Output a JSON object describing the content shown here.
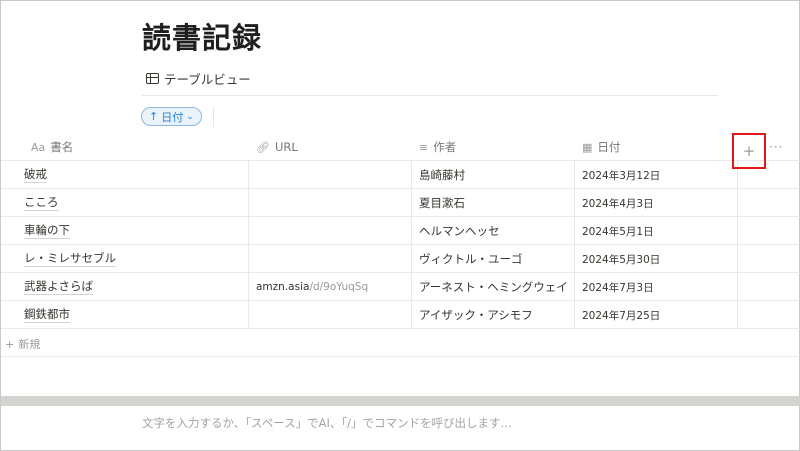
{
  "page": {
    "title": "読書記録",
    "view_name": "テーブルビュー",
    "view_icon": "table-icon"
  },
  "sort": {
    "label": "日付",
    "direction_icon": "arrow-up-icon",
    "chevron": "chevron-down-icon"
  },
  "columns": [
    {
      "id": "name",
      "label": "書名",
      "prefix": "Aa",
      "icon": "title-icon"
    },
    {
      "id": "url",
      "label": "URL",
      "icon": "link-icon"
    },
    {
      "id": "author",
      "label": "作者",
      "icon": "text-lines-icon"
    },
    {
      "id": "date",
      "label": "日付",
      "icon": "calendar-icon"
    }
  ],
  "rows": [
    {
      "name": "破戒",
      "url_host": "",
      "url_path": "",
      "author": "島崎藤村",
      "date": "2024年3月12日"
    },
    {
      "name": "こころ",
      "url_host": "",
      "url_path": "",
      "author": "夏目漱石",
      "date": "2024年4月3日"
    },
    {
      "name": "車輪の下",
      "url_host": "",
      "url_path": "",
      "author": "ヘルマンヘッセ",
      "date": "2024年5月1日"
    },
    {
      "name": "レ・ミレサセブル",
      "url_host": "",
      "url_path": "",
      "author": "ヴィクトル・ユーゴ",
      "date": "2024年5月30日"
    },
    {
      "name": "武器よさらば",
      "url_host": "amzn.asia",
      "url_path": "/d/9oYuqSq",
      "author": "アーネスト・ヘミングウェイ",
      "date": "2024年7月3日"
    },
    {
      "name": "鋼鉄都市",
      "url_host": "",
      "url_path": "",
      "author": "アイザック・アシモフ",
      "date": "2024年7月25日"
    }
  ],
  "add_column": {
    "icon": "plus-icon",
    "glyph": "+"
  },
  "more_glyph": "···",
  "new_row": {
    "glyph": "+",
    "label": "新規"
  },
  "editor": {
    "placeholder": "文字を入力するか、「スペース」でAI、「/」でコマンドを呼び出します..."
  },
  "colors": {
    "accent_blue": "#2383e2",
    "highlight_red": "#e31919",
    "text": "#37352f",
    "muted": "#787774"
  }
}
